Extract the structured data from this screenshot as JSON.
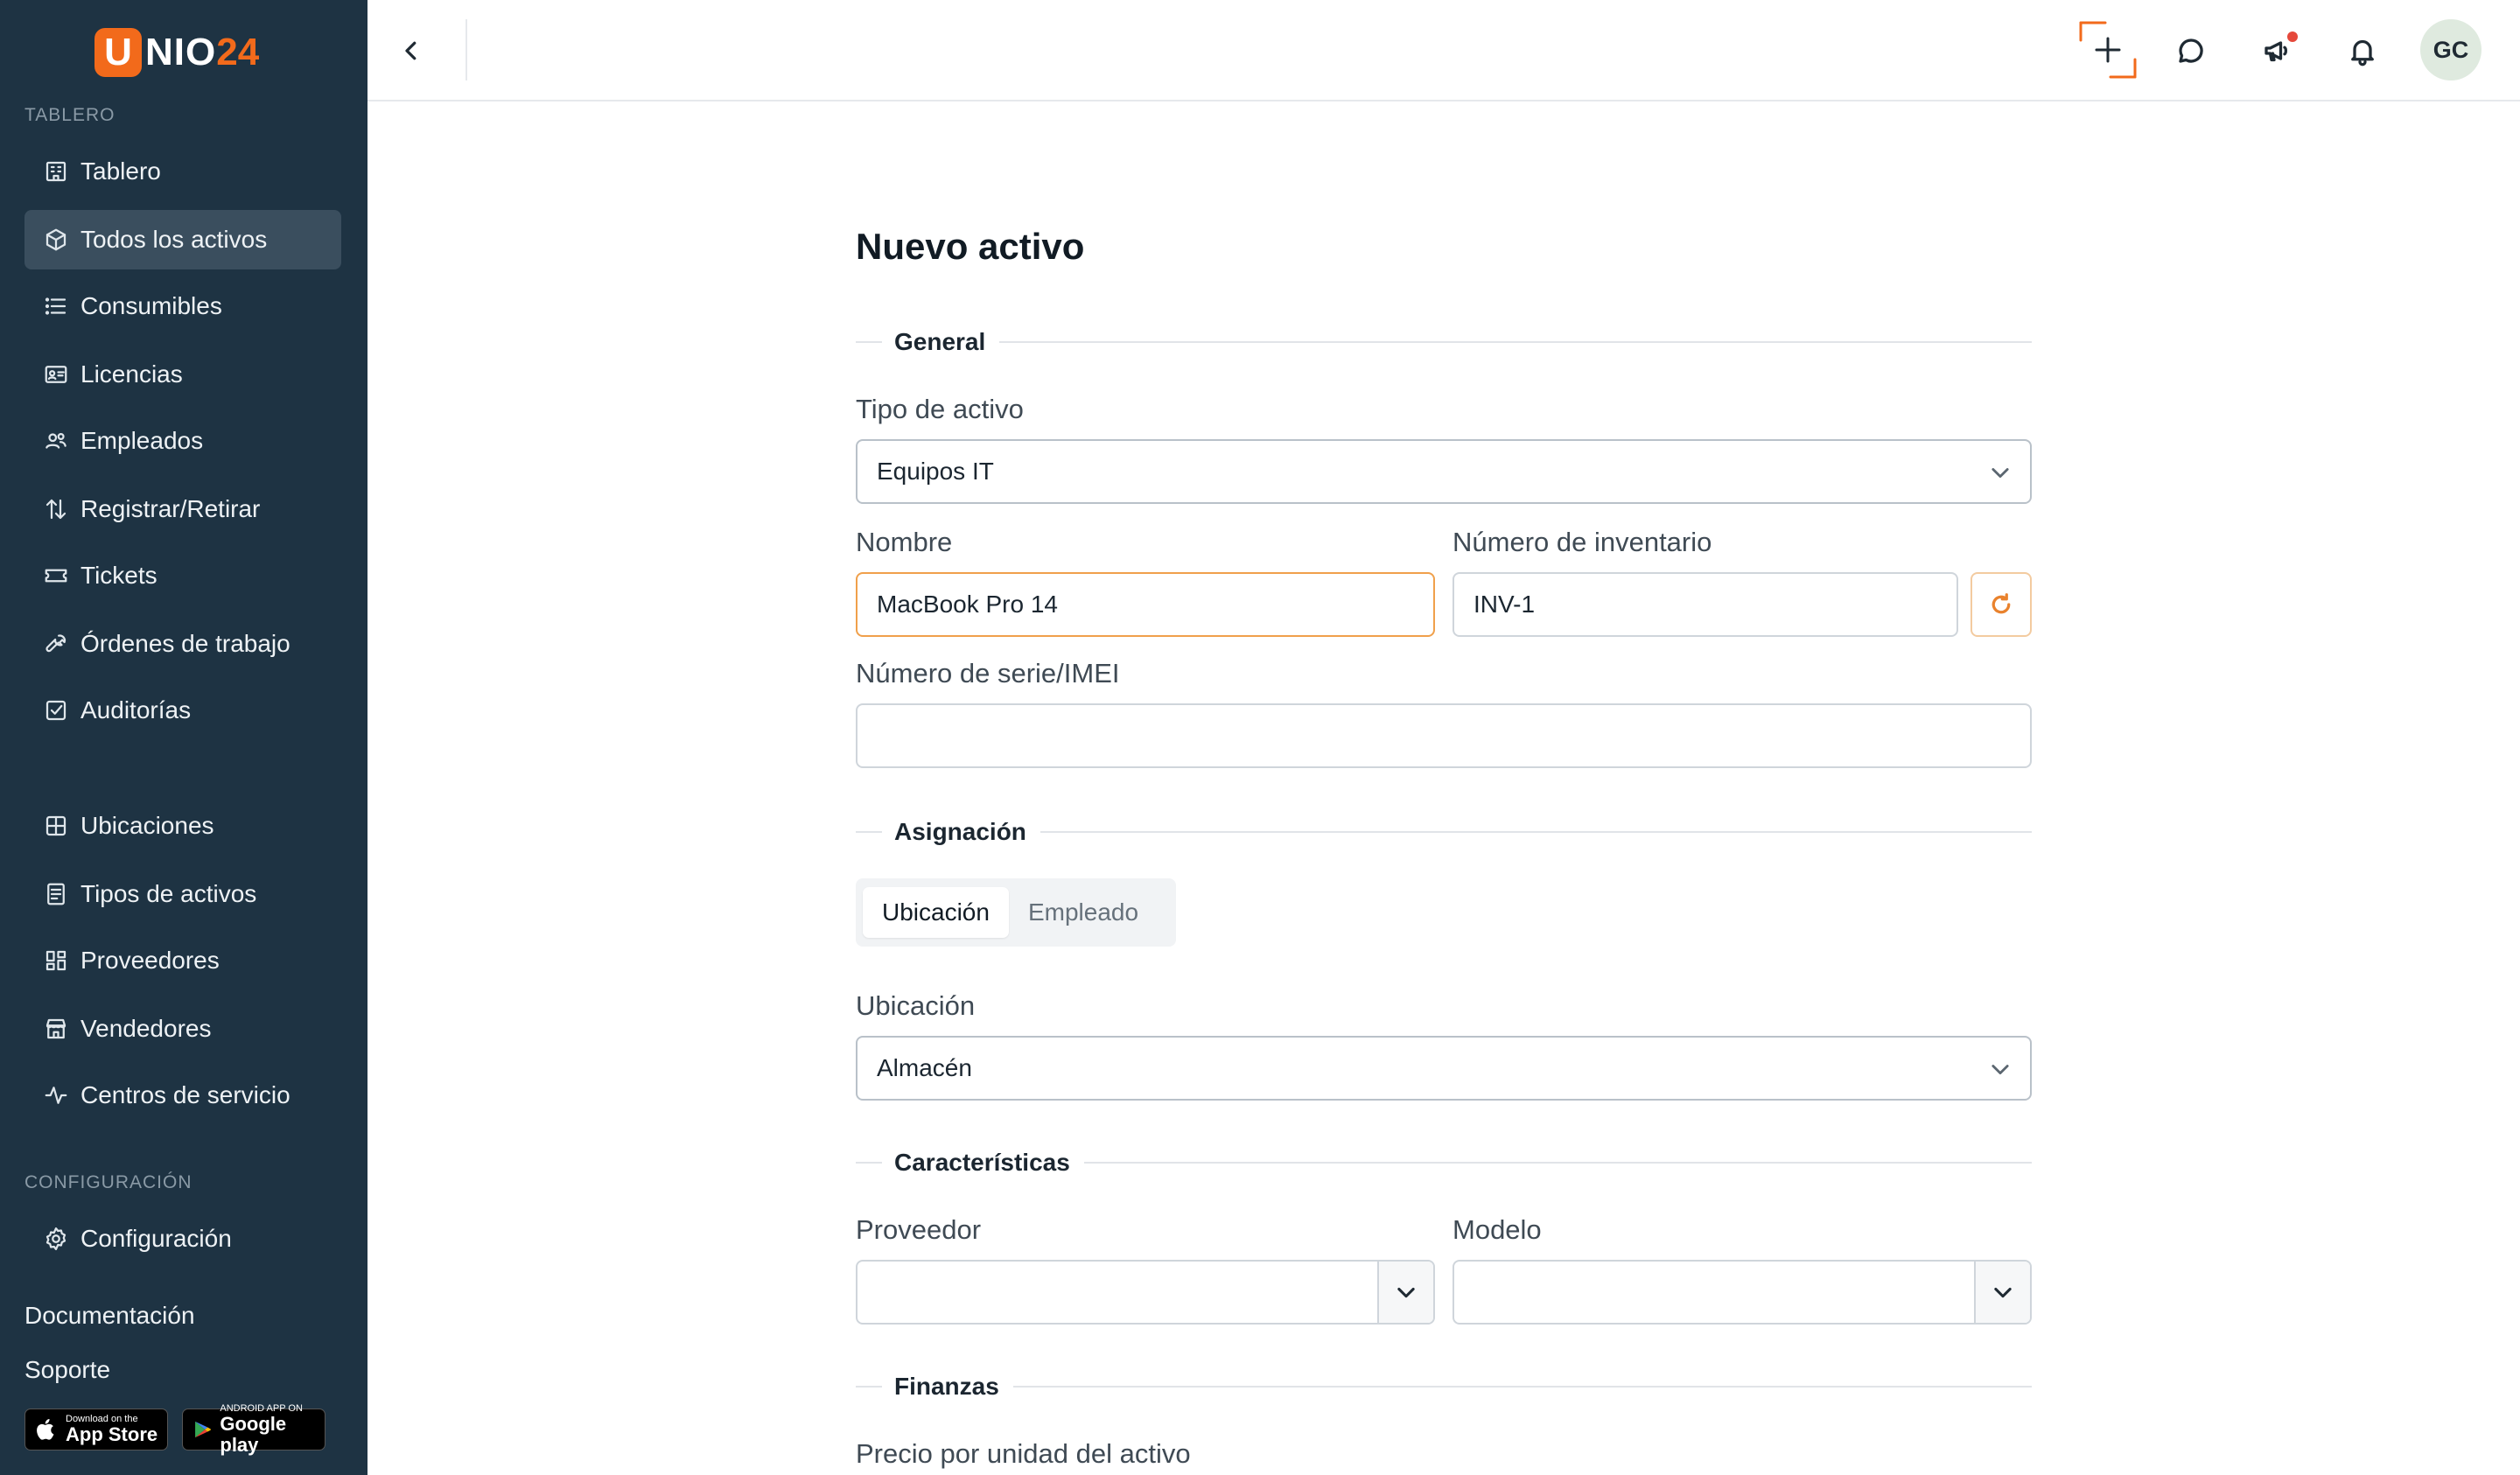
{
  "brand": {
    "logo_u": "U",
    "logo_nio": "NIO",
    "logo_24": "24"
  },
  "sidebar": {
    "section_dashboard": "TABLERO",
    "items": [
      {
        "label": "Tablero",
        "icon": "building-icon"
      },
      {
        "label": "Todos los activos",
        "icon": "box-icon",
        "active": true
      },
      {
        "label": "Consumibles",
        "icon": "list-icon"
      },
      {
        "label": "Licencias",
        "icon": "id-card-icon"
      },
      {
        "label": "Empleados",
        "icon": "users-icon"
      },
      {
        "label": "Registrar/Retirar",
        "icon": "arrows-updown-icon"
      },
      {
        "label": "Tickets",
        "icon": "ticket-icon"
      },
      {
        "label": "Órdenes de trabajo",
        "icon": "wrench-icon"
      },
      {
        "label": "Auditorías",
        "icon": "checkbox-icon"
      }
    ],
    "items2": [
      {
        "label": "Ubicaciones",
        "icon": "grid-icon"
      },
      {
        "label": "Tipos de activos",
        "icon": "document-icon"
      },
      {
        "label": "Proveedores",
        "icon": "apps-icon"
      },
      {
        "label": "Vendedores",
        "icon": "store-icon"
      },
      {
        "label": "Centros de servicio",
        "icon": "activity-icon"
      }
    ],
    "section_config": "CONFIGURACIÓN",
    "config_item": {
      "label": "Configuración",
      "icon": "gear-icon"
    },
    "documentation": "Documentación",
    "support": "Soporte",
    "app_store": {
      "small": "Download on the",
      "big": "App Store"
    },
    "google_play": {
      "small": "ANDROID APP ON",
      "big": "Google play"
    }
  },
  "topbar": {
    "avatar_initials": "GC",
    "accent_color": "#f26a1b"
  },
  "form": {
    "title": "Nuevo activo",
    "sections": {
      "general": "General",
      "assignment": "Asignación",
      "features": "Características",
      "finance": "Finanzas"
    },
    "asset_type": {
      "label": "Tipo de activo",
      "value": "Equipos IT"
    },
    "name": {
      "label": "Nombre",
      "value": "MacBook Pro 14"
    },
    "inventory_number": {
      "label": "Número de inventario",
      "value": "INV-1"
    },
    "serial": {
      "label": "Número de serie/IMEI",
      "value": ""
    },
    "assign_tabs": [
      {
        "label": "Ubicación",
        "active": true
      },
      {
        "label": "Empleado",
        "active": false
      }
    ],
    "location": {
      "label": "Ubicación",
      "value": "Almacén"
    },
    "supplier": {
      "label": "Proveedor",
      "value": ""
    },
    "model": {
      "label": "Modelo",
      "value": ""
    },
    "unit_price": {
      "label": "Precio por unidad del activo"
    }
  }
}
